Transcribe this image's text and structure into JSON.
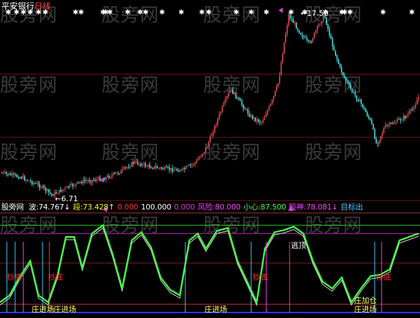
{
  "header": {
    "symbol": "平安银行",
    "period": "日线"
  },
  "price_panel": {
    "high_label": "17.50",
    "low_label": "6.71"
  },
  "indicator_bar": {
    "name": "股旁网",
    "items": [
      {
        "label": "波:",
        "value": "74.767",
        "arrow": "↓",
        "color": "#ffffff"
      },
      {
        "label": "段:",
        "value": "73.428",
        "arrow": "↑",
        "color": "#ffff00"
      },
      {
        "label": "",
        "value": "0.000",
        "arrow": "",
        "color": "#ff3333"
      },
      {
        "label": "",
        "value": "100.000",
        "arrow": "",
        "color": "#ffffff"
      },
      {
        "label": "",
        "value": "0.000",
        "arrow": "",
        "color": "#cc44cc"
      },
      {
        "label": "风险:",
        "value": "80.000",
        "arrow": "",
        "color": "#ff44ff"
      },
      {
        "label": "小心:",
        "value": "87.500",
        "arrow": "",
        "color": "#44ff44"
      },
      {
        "label": "股神:",
        "value": "78.081",
        "arrow": "↓",
        "color": "#ff44ff"
      },
      {
        "label": "目标出",
        "value": "",
        "arrow": "",
        "color": "#44ccff"
      }
    ]
  },
  "signals": {
    "escape": "逃顶",
    "bottom_a": "抄底",
    "bottom_b": "抄底",
    "bottom_c": "抄底",
    "bottom_d": "抄底",
    "enter_a": "庄进场",
    "enter_b": "庄进场",
    "enter_c": "庄进场",
    "enter_d": "庄进场",
    "add_pos": "庄加仓"
  },
  "watermark": "股旁网",
  "colors": {
    "up": "#ff5555",
    "down": "#55ffff",
    "ma_line": "#ffffff",
    "indicator": "#44ff44"
  }
}
